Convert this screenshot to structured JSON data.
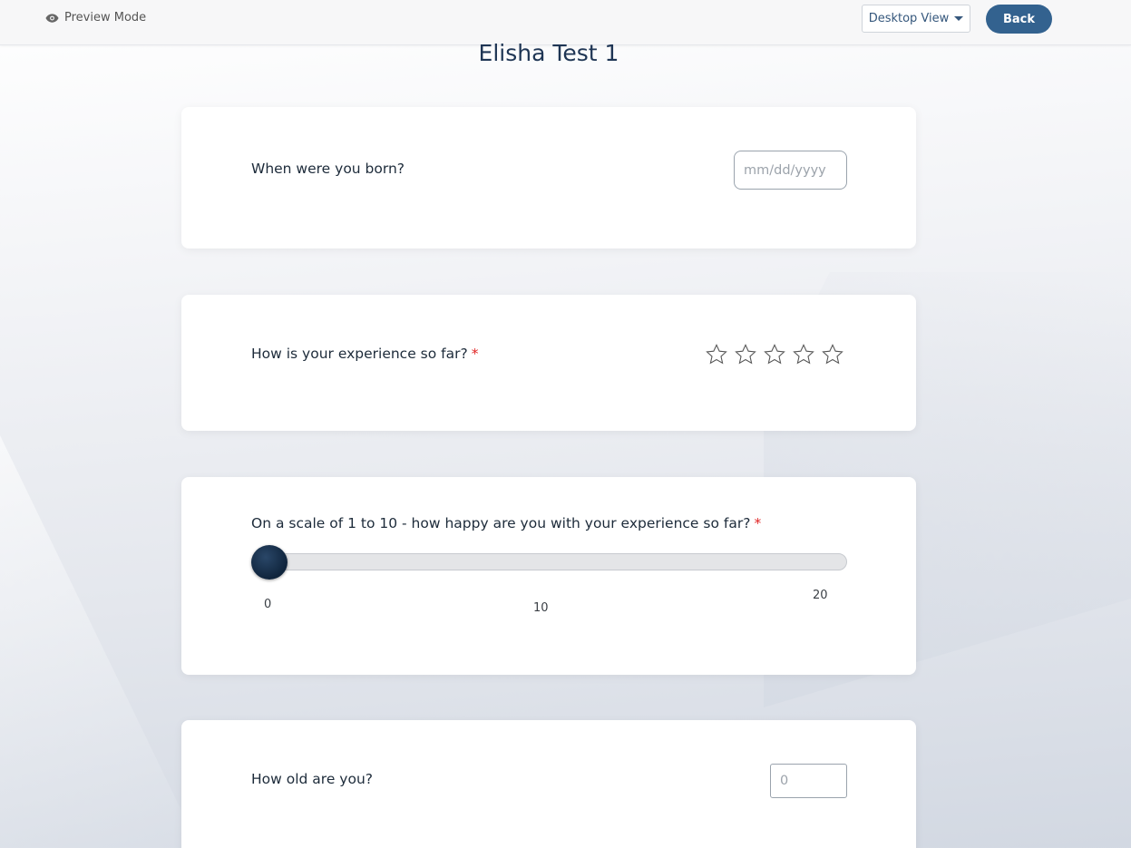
{
  "topbar": {
    "preview_label": "Preview Mode",
    "view_select_label": "Desktop View",
    "back_label": "Back"
  },
  "form": {
    "title": "Elisha Test 1",
    "q1": {
      "label": "When were you born?",
      "placeholder": "mm/dd/yyyy"
    },
    "q2": {
      "label": "How is your experience so far?",
      "required_mark": "*",
      "stars_total": 5,
      "stars_selected": 0
    },
    "q3": {
      "label": "On a scale of 1 to 10 - how happy are you with your experience so far?",
      "required_mark": "*",
      "slider_value": 0,
      "tick_min": "0",
      "tick_mid": "10",
      "tick_max": "20"
    },
    "q4": {
      "label": "How old are you?",
      "placeholder": "0"
    }
  },
  "colors": {
    "accent": "#33628f",
    "title": "#1e3554",
    "required": "#e02424",
    "slider_thumb": "#0f243c"
  },
  "icons": {
    "preview": "eye-icon",
    "dropdown": "caret-down-icon",
    "rating": "star-outline-icon"
  }
}
